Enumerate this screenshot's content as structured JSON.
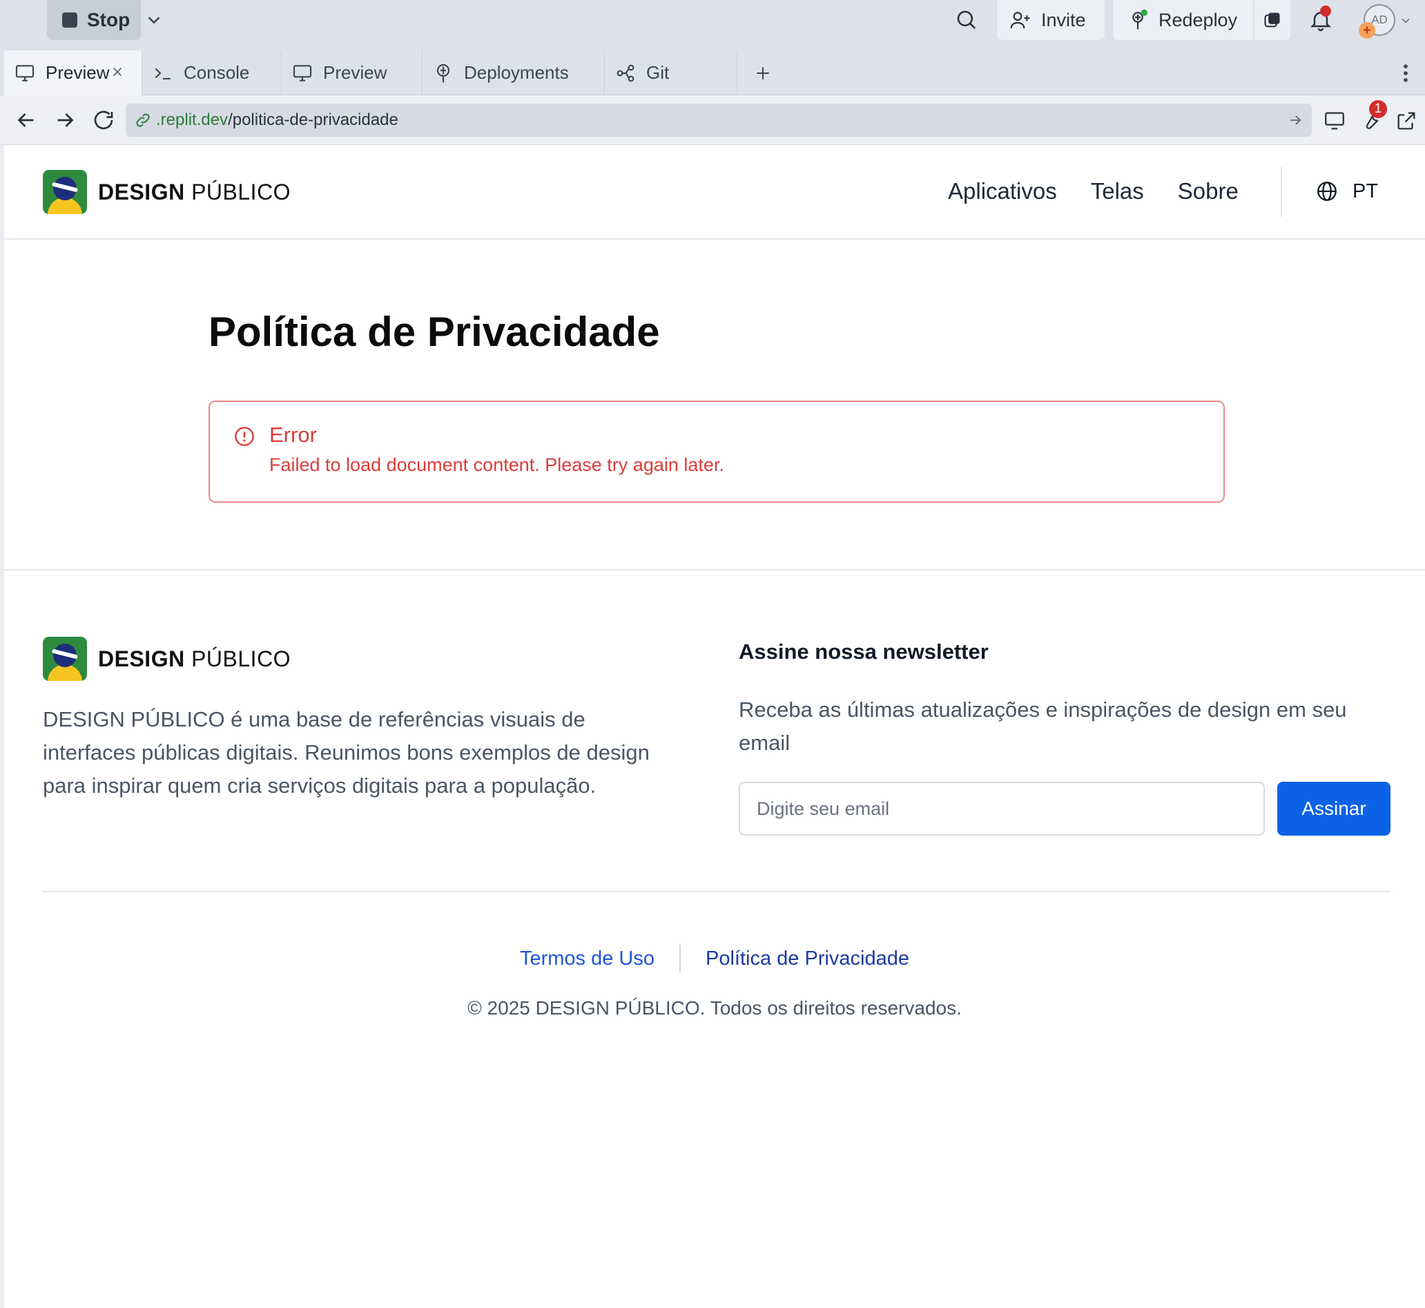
{
  "topbar": {
    "stop_label": "Stop",
    "invite_label": "Invite",
    "redeploy_label": "Redeploy",
    "avatar_initials": "AD",
    "avatar_badge": "+"
  },
  "tabs": [
    {
      "label": "Preview",
      "icon": "monitor-icon",
      "active": true,
      "closable": true
    },
    {
      "label": "Console",
      "icon": "terminal-icon"
    },
    {
      "label": "Preview",
      "icon": "monitor-icon"
    },
    {
      "label": "Deployments",
      "icon": "deployments-icon"
    },
    {
      "label": "Git",
      "icon": "git-icon"
    }
  ],
  "urlbar": {
    "domain": ".replit.dev",
    "path": "/politica-de-privacidade",
    "devtools_badge": "1"
  },
  "site": {
    "brand_bold": "DESIGN",
    "brand_rest": "PÚBLICO",
    "nav": [
      "Aplicativos",
      "Telas",
      "Sobre"
    ],
    "language": "PT",
    "page_title": "Política de Privacidade",
    "error": {
      "title": "Error",
      "message": "Failed to load document content. Please try again later."
    },
    "footer": {
      "description": "DESIGN PÚBLICO é uma base de referências visuais de interfaces públicas digitais. Reunimos bons exemplos de design para inspirar quem cria serviços digitais para a população.",
      "newsletter_title": "Assine nossa newsletter",
      "newsletter_desc": "Receba as últimas atualizações e inspirações de design em seu email",
      "email_placeholder": "Digite seu email",
      "subscribe_label": "Assinar",
      "links": [
        "Termos de Uso",
        "Política de Privacidade"
      ],
      "copyright": "© 2025 DESIGN PÚBLICO. Todos os direitos reservados."
    }
  },
  "colors": {
    "accent": "#0b62e6",
    "error": "#dc3b3b",
    "link": "#1f55d6"
  }
}
